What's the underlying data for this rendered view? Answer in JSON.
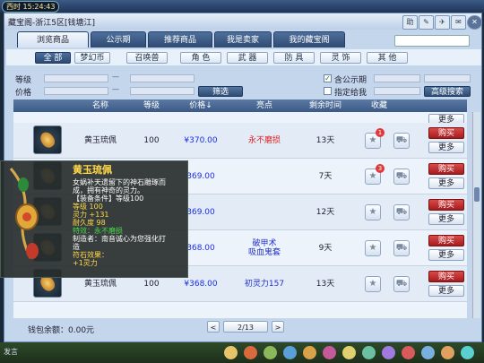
{
  "hud": {
    "clock_label": "西时",
    "clock": "15:24:43",
    "chat_hint": "发言"
  },
  "window": {
    "title": "藏宝阁-浙江5区[钱塘江]"
  },
  "title_buttons": [
    "助",
    "✎",
    "✈",
    "✉",
    "✕"
  ],
  "nav_tabs": [
    "浏览商品",
    "公示期",
    "推荐商品",
    "我是卖家",
    "我的藏宝阁"
  ],
  "categories": [
    "全 部",
    "梦幻币",
    "召唤兽",
    "角 色",
    "武 器",
    "防 具",
    "灵 饰",
    "其 他"
  ],
  "filters": {
    "level_label": "等级",
    "price_label": "价格",
    "filter_button": "筛选",
    "public_label": "含公示期",
    "public_checked": true,
    "target_label": "指定给我",
    "advanced_button": "高级搜索"
  },
  "columns": [
    "名称",
    "等级",
    "价格↓",
    "亮点",
    "剩余时间",
    "收藏"
  ],
  "rows": [
    {
      "name": "黄玉琉佩",
      "level": "100",
      "price": "¥370.00",
      "feature": "永不磨损",
      "feature_color": "#d22",
      "time": "13天",
      "fav_count": "1",
      "buy": "购买",
      "more": "更多"
    },
    {
      "name": "",
      "level": "",
      "price": "369.00",
      "feature": "",
      "feature_color": "#d22",
      "time": "7天",
      "fav_count": "3",
      "buy": "购买",
      "more": "更多"
    },
    {
      "name": "",
      "level": "",
      "price": "369.00",
      "feature": "",
      "feature_color": "#d22",
      "time": "12天",
      "fav_count": "",
      "buy": "购买",
      "more": "更多"
    },
    {
      "name": "",
      "level": "",
      "price": "368.00",
      "feature": "破甲术\n吸血鬼套",
      "feature_color": "#2030c8",
      "time": "9天",
      "fav_count": "",
      "buy": "购买",
      "more": "更多"
    },
    {
      "name": "黄玉琉佩",
      "level": "100",
      "price": "¥368.00",
      "feature": "初灵力157",
      "feature_color": "#2030c8",
      "time": "13天",
      "fav_count": "",
      "buy": "购买",
      "more": "更多"
    }
  ],
  "partial_more": "更多",
  "footer": {
    "wallet_label": "钱包余额：",
    "wallet_value": "0.00元",
    "prev": "<",
    "page": "2/13",
    "next": ">"
  },
  "tooltip": {
    "title": "黄玉琉佩",
    "lines": [
      {
        "text": "女娲补天遗留下的神石雕琢而",
        "color": "#ffffff"
      },
      {
        "text": "成，拥有神奇的灵力。",
        "color": "#ffffff"
      },
      {
        "text": "【装备条件】等级100",
        "color": "#ffffff"
      },
      {
        "text": "等级 100",
        "color": "#ffd84a"
      },
      {
        "text": "灵力 +131",
        "color": "#ffd84a"
      },
      {
        "text": "耐久度 98",
        "color": "#ffd84a"
      },
      {
        "text": "特效：永不磨损",
        "color": "#4ad84a"
      },
      {
        "text": "制造者：南音诚心为您强化打",
        "color": "#ffffff"
      },
      {
        "text": "造",
        "color": "#ffffff"
      },
      {
        "text": "符石效果：",
        "color": "#ffd84a"
      },
      {
        "text": "+1灵力",
        "color": "#ffd84a"
      }
    ]
  },
  "colors": {
    "accent": "#2e4a72",
    "buy": "#b62828",
    "price": "#1a2ee8"
  }
}
